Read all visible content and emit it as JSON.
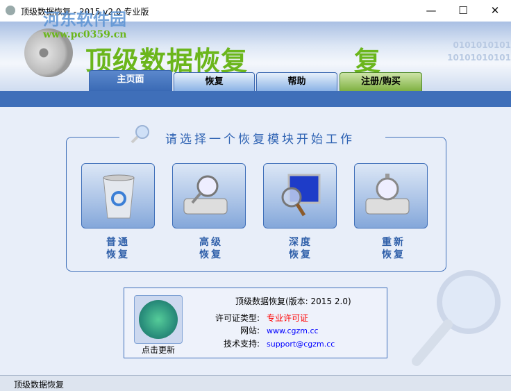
{
  "window": {
    "title": "顶级数据恢复 - 2015 v2.0 专业版",
    "minimize": "—",
    "maximize": "☐",
    "close": "✕"
  },
  "watermark": {
    "name": "河东软件园",
    "url": "www.pc0359.cn"
  },
  "banner": {
    "title": "顶级数据恢复",
    "title_tail": "复",
    "binary": "0101010101\n10101010101"
  },
  "tabs": [
    {
      "label": "主页面"
    },
    {
      "label": "恢复"
    },
    {
      "label": "帮助"
    },
    {
      "label": "注册/购买"
    }
  ],
  "panel": {
    "heading": "请选择一个恢复模块开始工作",
    "modules": [
      {
        "line1": "普通",
        "line2": "恢复",
        "icon": "recycle-bin-icon"
      },
      {
        "line1": "高级",
        "line2": "恢复",
        "icon": "drive-search-icon"
      },
      {
        "line1": "深度",
        "line2": "恢复",
        "icon": "monitor-search-icon"
      },
      {
        "line1": "重新",
        "line2": "恢复",
        "icon": "drive-stopwatch-icon"
      }
    ]
  },
  "info": {
    "update_label": "点击更新",
    "version": "顶级数据恢复(版本: 2015 2.0)",
    "license_label": "许可证类型:",
    "license_value": "专业许可证",
    "website_label": "网站:",
    "website_value": "www.cgzm.cc",
    "support_label": "技术支持:",
    "support_value": "support@cgzm.cc"
  },
  "status": {
    "text": "顶级数据恢复"
  },
  "colors": {
    "accent": "#3f6fb9",
    "license": "#ff0000",
    "link": "#0000ff",
    "green": "#6bb61c"
  }
}
